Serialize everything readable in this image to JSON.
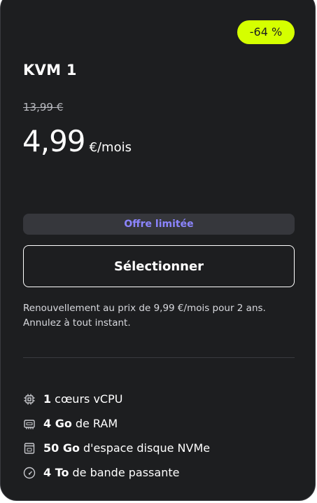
{
  "plan": {
    "discount_badge": "-64 %",
    "name": "KVM 1",
    "old_price": "13,99 €",
    "price": "4,99",
    "period": "€/mois",
    "limited_offer": "Offre limitée",
    "select_button": "Sélectionner",
    "renewal_line1": "Renouvellement au prix de 9,99 €/mois pour 2 ans.",
    "renewal_line2": "Annulez à tout instant."
  },
  "features": [
    {
      "icon": "cpu-icon",
      "value": "1",
      "label": "cœurs vCPU"
    },
    {
      "icon": "ram-icon",
      "value": "4 Go",
      "label": "de RAM"
    },
    {
      "icon": "disk-icon",
      "value": "50 Go",
      "label": "d'espace disque NVMe"
    },
    {
      "icon": "gauge-icon",
      "value": "4 To",
      "label": "de bande passante"
    }
  ],
  "colors": {
    "card_background": "#1d1e20",
    "badge_accent": "#d5ff00",
    "limited_offer_text": "#8c85ff"
  }
}
